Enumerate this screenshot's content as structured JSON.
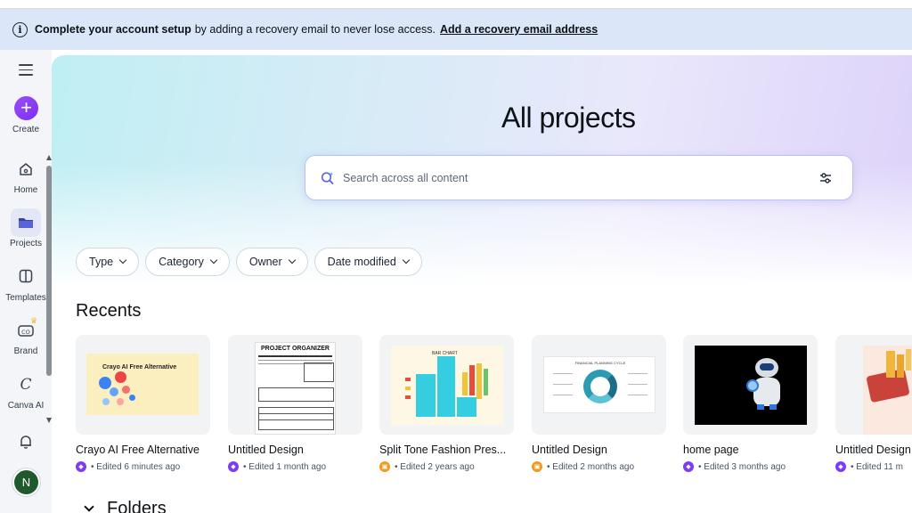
{
  "banner": {
    "strong": "Complete your account setup",
    "message": "by adding a recovery email to never lose access.",
    "link": "Add a recovery email address"
  },
  "sidebar": {
    "items": [
      {
        "label": "Create",
        "icon": "plus-icon"
      },
      {
        "label": "Home",
        "icon": "home-icon"
      },
      {
        "label": "Projects",
        "icon": "folder-icon"
      },
      {
        "label": "Templates",
        "icon": "templates-icon"
      },
      {
        "label": "Brand",
        "icon": "brand-icon"
      },
      {
        "label": "Canva AI",
        "icon": "canva-ai-icon"
      }
    ],
    "avatar_initial": "N"
  },
  "main": {
    "title": "All projects",
    "search_placeholder": "Search across all content",
    "filters": [
      "Type",
      "Category",
      "Owner",
      "Date modified"
    ],
    "recents_title": "Recents",
    "folders_title": "Folders",
    "recents": [
      {
        "name": "Crayo AI Free Alternative",
        "meta": "Edited 6 minutes ago",
        "badge": "purple",
        "thumb_text": "Crayo AI Free Alternative"
      },
      {
        "name": "Untitled Design",
        "meta": "Edited 1 month ago",
        "badge": "purple",
        "thumb_text": "PROJECT ORGANIZER"
      },
      {
        "name": "Split Tone Fashion Pres...",
        "meta": "Edited 2 years ago",
        "badge": "orange",
        "thumb_text": "BAR CHART"
      },
      {
        "name": "Untitled Design",
        "meta": "Edited 2 months ago",
        "badge": "orange",
        "thumb_text": "FINANCIAL PLANNING CYCLE"
      },
      {
        "name": "home page",
        "meta": "Edited 3 months ago",
        "badge": "purple",
        "thumb_text": ""
      },
      {
        "name": "Untitled Design",
        "meta": "Edited 11 m",
        "badge": "purple",
        "thumb_text": ""
      }
    ]
  },
  "colors": {
    "accent": "#7d3cf3",
    "banner_bg": "#dbe6f8",
    "avatar_bg": "#1e5a2c"
  }
}
